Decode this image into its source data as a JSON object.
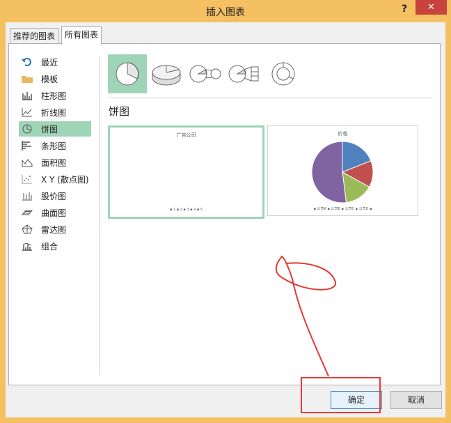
{
  "window": {
    "title": "插入图表",
    "help_label": "?",
    "close_label": "✕"
  },
  "tabs": [
    {
      "label": "推荐的图表",
      "active": false
    },
    {
      "label": "所有图表",
      "active": true
    }
  ],
  "sidebar": {
    "items": [
      {
        "label": "最近",
        "icon": "undo-icon",
        "selected": false
      },
      {
        "label": "模板",
        "icon": "folder-icon",
        "selected": false
      },
      {
        "label": "柱形图",
        "icon": "column-chart-icon",
        "selected": false
      },
      {
        "label": "折线图",
        "icon": "line-chart-icon",
        "selected": false
      },
      {
        "label": "饼图",
        "icon": "pie-chart-icon",
        "selected": true
      },
      {
        "label": "条形图",
        "icon": "bar-chart-icon",
        "selected": false
      },
      {
        "label": "面积图",
        "icon": "area-chart-icon",
        "selected": false
      },
      {
        "label": "X Y (散点图)",
        "icon": "scatter-chart-icon",
        "selected": false
      },
      {
        "label": "股价图",
        "icon": "stock-chart-icon",
        "selected": false
      },
      {
        "label": "曲面图",
        "icon": "surface-chart-icon",
        "selected": false
      },
      {
        "label": "雷达图",
        "icon": "radar-chart-icon",
        "selected": false
      },
      {
        "label": "组合",
        "icon": "combo-chart-icon",
        "selected": false
      }
    ]
  },
  "subtypes": [
    {
      "icon": "pie-icon",
      "selected": true
    },
    {
      "icon": "3d-pie-icon",
      "selected": false
    },
    {
      "icon": "pie-of-pie-icon",
      "selected": false
    },
    {
      "icon": "bar-of-pie-icon",
      "selected": false
    },
    {
      "icon": "doughnut-icon",
      "selected": false
    }
  ],
  "section_heading": "饼图",
  "previews": [
    {
      "title": "广告公司",
      "legend": "▪ 1  ▪ 2  ▪ 3  ▪ 4  ▪ 5",
      "selected": true
    },
    {
      "title": "价格",
      "legend": "▪ 公司A  ▪ 公司B  ▪ 公司C  ▪ 公司D  ▪",
      "selected": false
    }
  ],
  "preview_pie": {
    "slices": [
      {
        "color": "#4f81bd",
        "value": 19
      },
      {
        "color": "#c0504d",
        "value": 14
      },
      {
        "color": "#9bbb59",
        "value": 15
      },
      {
        "color": "#8064a2",
        "value": 52
      }
    ]
  },
  "buttons": {
    "ok": "确定",
    "cancel": "取消"
  },
  "colors": {
    "titlebar": "#f5c062",
    "selection": "#9fd5b7",
    "close": "#c7433c",
    "annotation": "#e53935"
  }
}
